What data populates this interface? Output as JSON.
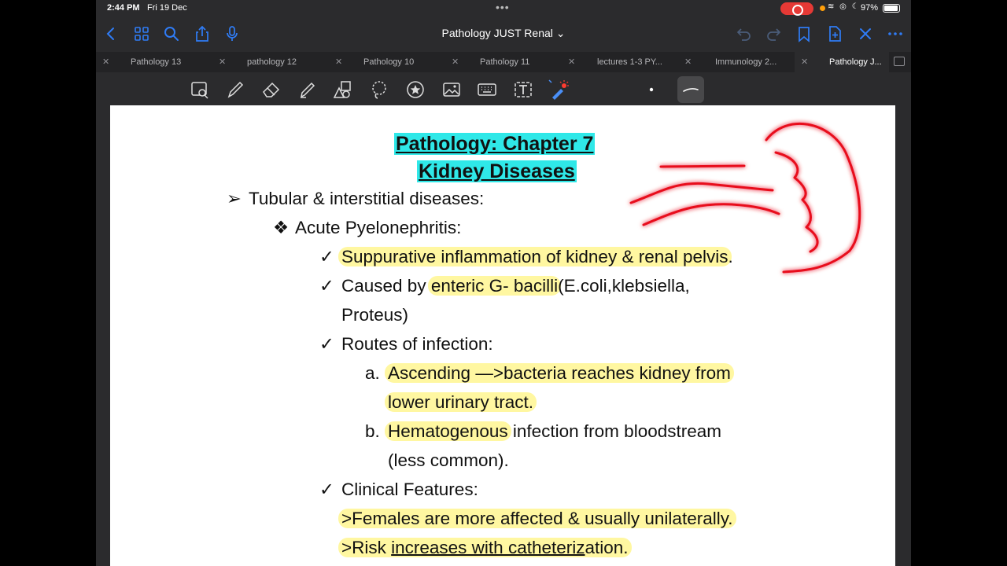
{
  "status_bar": {
    "time": "2:44 PM",
    "date": "Fri 19 Dec",
    "battery": "97%"
  },
  "nav_bar": {
    "title": "Pathology JUST Renal ⌄",
    "accent_color": "#2f7cf6"
  },
  "tabs": [
    {
      "label": "Pathology 13",
      "active": false
    },
    {
      "label": "pathology 12",
      "active": false
    },
    {
      "label": "Pathology 10",
      "active": false
    },
    {
      "label": "Pathology 11",
      "active": false
    },
    {
      "label": "lectures 1-3 PY...",
      "active": false
    },
    {
      "label": "Immunology 2...",
      "active": false
    },
    {
      "label": "Pathology J...",
      "active": true
    }
  ],
  "toolbar": {
    "tools": [
      "zoom-box-icon",
      "pen-icon",
      "eraser-icon",
      "highlighter-icon",
      "shapes-icon",
      "lasso-icon",
      "sticker-icon",
      "image-icon",
      "keyboard-icon",
      "text-box-icon",
      "laser-pointer-icon",
      "pen-size-dot-icon",
      "stroke-style-icon"
    ]
  },
  "document": {
    "title_line1": "Pathology: Chapter 7",
    "title_line2": "Kidney Diseases",
    "heading": "Tubular & interstitial diseases:",
    "subheading": "Acute Pyelonephritis:",
    "b1": "Suppurative inflammation of kidney & renal pelvis",
    "b1_end": ".",
    "b2_a": "Caused by",
    "b2_b": "enteric G- bacilli",
    "b2_c": "(E.coli,klebsiella,",
    "b2_d": "Proteus)",
    "b3": "Routes of infection:",
    "a_label": "a.",
    "a_text1": "Ascending —>bacteria reaches kidney from",
    "a_text2": "lower urinary tract.",
    "b_label": "b.",
    "b_text_hl": "Hematogenous",
    "b_text_rest": "infection from bloodstream",
    "b_text2": "(less common).",
    "b4": "Clinical Features:",
    "cf1": ">Females are more affected & usually unilaterally.",
    "cf2_a": ">Risk ",
    "cf2_b": "increases with catheteriz",
    "cf2_c": "ation.",
    "arrow_bullet": "➢",
    "diamond_bullet": "❖",
    "check_bullet": "✓",
    "highlight_color": "#fff36e",
    "title_bg": "#2fe8e8",
    "scribble_color": "#e8101a"
  }
}
